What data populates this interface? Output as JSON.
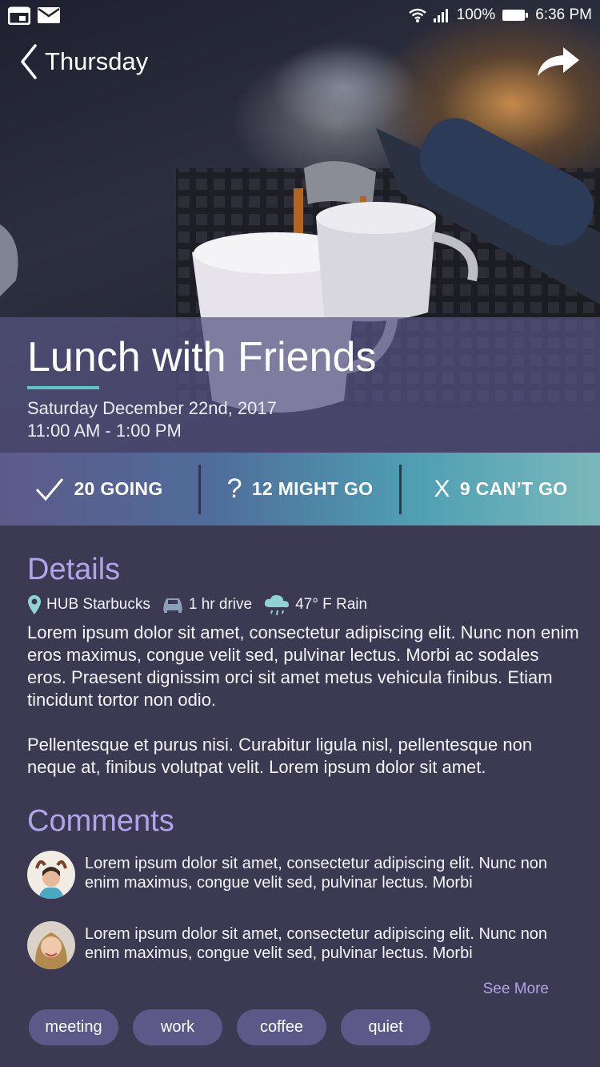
{
  "status_bar": {
    "battery": "100%",
    "time": "6:36 PM"
  },
  "nav": {
    "back_label": "Thursday"
  },
  "event": {
    "title": "Lunch with Friends",
    "date": "Saturday December 22nd, 2017",
    "time": "11:00 AM - 1:00 PM"
  },
  "rsvp": {
    "going_label": "20 GOING",
    "might_go_label": "12 MIGHT GO",
    "might_go_icon": "?",
    "cant_go_label": "9 CAN’T GO",
    "cant_go_icon": "X"
  },
  "details": {
    "title": "Details",
    "location": "HUB Starbucks",
    "drive": "1 hr drive",
    "weather": "47° F Rain",
    "paragraph_1": "Lorem ipsum dolor sit amet, consectetur adipiscing elit. Nunc non enim eros maximus, congue velit sed, pulvinar lectus. Morbi ac sodales eros. Praesent dignissim orci sit amet metus vehicula finibus. Etiam tincidunt tortor non odio.",
    "paragraph_2": "Pellentesque et purus nisi. Curabitur ligula nisl, pellentesque non neque at, finibus volutpat velit. Lorem ipsum dolor sit amet."
  },
  "comments": {
    "title": "Comments",
    "items": [
      {
        "text": "Lorem ipsum dolor sit amet, consectetur adipiscing elit. Nunc non enim maximus, congue velit sed, pulvinar lectus. Morbi"
      },
      {
        "text": "Lorem ipsum dolor sit amet, consectetur adipiscing elit. Nunc non enim maximus, congue velit sed, pulvinar lectus. Morbi"
      }
    ],
    "see_more": "See More"
  },
  "tags": [
    "meeting",
    "work",
    "coffee",
    "quiet"
  ],
  "colors": {
    "background": "#3c3a52",
    "accent": "#b3a4e8",
    "underline": "#5cc7c9",
    "tag": "#5c5887"
  }
}
